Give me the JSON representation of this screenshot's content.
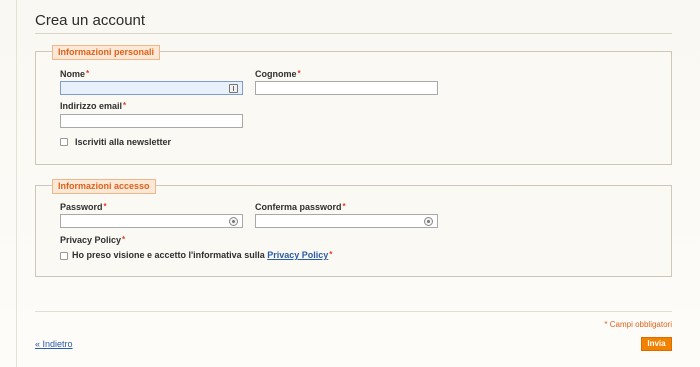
{
  "page": {
    "title": "Crea un account"
  },
  "personal_info": {
    "legend": "Informazioni personali",
    "first_name_label": "Nome",
    "first_name_value": "",
    "last_name_label": "Cognome",
    "last_name_value": "",
    "email_label": "Indirizzo email",
    "email_value": "",
    "newsletter_label": "Iscriviti alla newsletter",
    "required_mark": "*"
  },
  "access_info": {
    "legend": "Informazioni accesso",
    "password_label": "Password",
    "password_value": "",
    "confirm_label": "Conferma password",
    "confirm_value": "",
    "privacy_label": "Privacy Policy",
    "privacy_text": "Ho preso visione e accetto l'informativa sulla",
    "privacy_link": "Privacy Policy",
    "required_mark": "*"
  },
  "footer": {
    "required_note": "* Campi obbligatori",
    "back_link": "« Indietro",
    "submit_label": "Invia"
  },
  "icons": {
    "first_name_field_icon": "autofill-card-icon",
    "password_field_icon": "password-key-icon",
    "confirm_field_icon": "password-key-icon"
  },
  "colors": {
    "accent_orange": "#f18200",
    "legend_text": "#e0621b",
    "required_star": "#e53b24",
    "link_blue": "#2b5ca8"
  }
}
